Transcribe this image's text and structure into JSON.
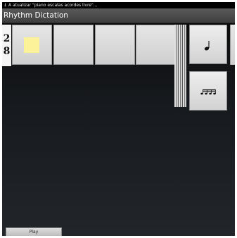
{
  "status_bar": {
    "download_icon": "download-arrow-icon",
    "text": "A atualizar \"piano escalas acordes livre\"..."
  },
  "app": {
    "title": "Rhythm Dictation"
  },
  "time_signature": {
    "top": "2",
    "bottom": "8"
  },
  "measure": {
    "cells": [
      {
        "id": "beat-1",
        "filled": true
      },
      {
        "id": "beat-2",
        "filled": false
      },
      {
        "id": "beat-3",
        "filled": false
      },
      {
        "id": "beat-4",
        "filled": false
      }
    ]
  },
  "palette": [
    {
      "name": "quarter-note-icon"
    },
    {
      "name": "four-sixteenth-notes-icon"
    }
  ],
  "controls": {
    "play_label": "Play"
  }
}
